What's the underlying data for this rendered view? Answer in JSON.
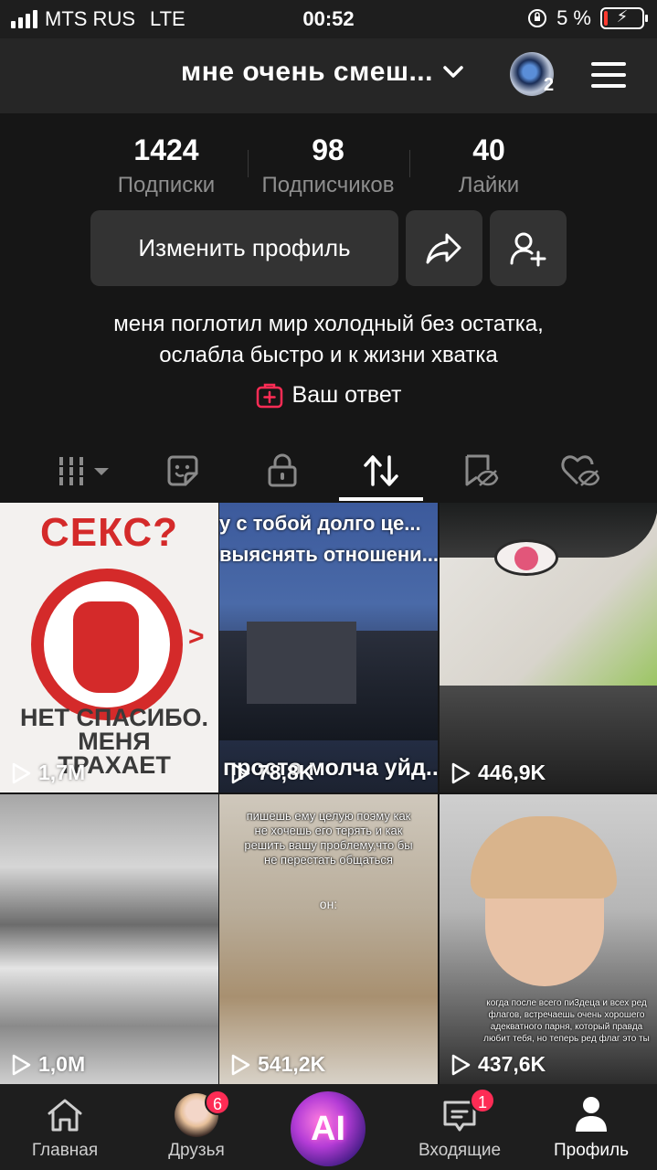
{
  "status_bar": {
    "carrier": "MTS RUS",
    "network": "LTE",
    "time": "00:52",
    "battery": "5 %"
  },
  "header": {
    "username": "мне очень смеш...",
    "account_count": "2"
  },
  "stats": [
    {
      "value": "1424",
      "label": "Подписки"
    },
    {
      "value": "98",
      "label": "Подписчиков"
    },
    {
      "value": "40",
      "label": "Лайки"
    }
  ],
  "actions": {
    "edit_profile": "Изменить профиль"
  },
  "bio": {
    "line1": "меня поглотил мир холодный без остатка,",
    "line2": "ослабла быстро и к жизни хватка"
  },
  "answer_label": "Ваш ответ",
  "tabs": [
    "videos-grid",
    "stickers",
    "private",
    "reposts",
    "favorites-hidden",
    "liked-hidden"
  ],
  "grid": [
    {
      "views": "1,7M",
      "overlay_top": "СЕКС?",
      "overlay_bottom": "НЕТ СПАСИБО. МЕНЯ ТРАХАЕТ"
    },
    {
      "views": "78,8K",
      "overlay_top": "у с тобой долго це...",
      "overlay_mid": "выяснять отношени...",
      "overlay_bottom": "просто молча уйд..."
    },
    {
      "views": "446,9K"
    },
    {
      "views": "1,0M"
    },
    {
      "views": "541,2K",
      "overlay_text": "пишешь ему целую поэму как не хочешь его терять и как решить вашу проблему,что бы не перестать общаться",
      "overlay_sub": "он:"
    },
    {
      "views": "437,6K",
      "overlay_text": "когда после всего пи3деца и всех ред флагов, встречаешь очень хорошего адекватного парня, который правда любит тебя, но теперь ред флаг это ты"
    }
  ],
  "bottom_nav": {
    "home": "Главная",
    "friends": "Друзья",
    "friends_badge": "6",
    "ai": "AI",
    "inbox": "Входящие",
    "inbox_badge": "1",
    "profile": "Профиль"
  }
}
